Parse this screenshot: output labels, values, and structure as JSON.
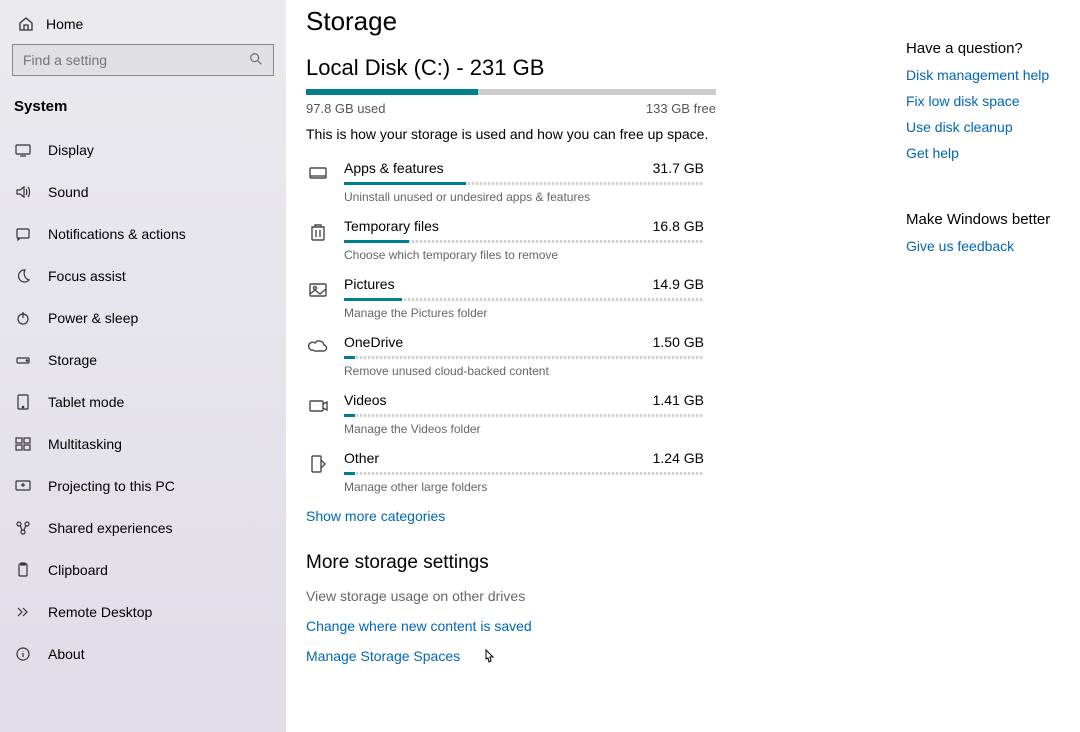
{
  "sidebar": {
    "home": "Home",
    "search_placeholder": "Find a setting",
    "system_label": "System",
    "items": [
      {
        "label": "Display"
      },
      {
        "label": "Sound"
      },
      {
        "label": "Notifications & actions"
      },
      {
        "label": "Focus assist"
      },
      {
        "label": "Power & sleep"
      },
      {
        "label": "Storage"
      },
      {
        "label": "Tablet mode"
      },
      {
        "label": "Multitasking"
      },
      {
        "label": "Projecting to this PC"
      },
      {
        "label": "Shared experiences"
      },
      {
        "label": "Clipboard"
      },
      {
        "label": "Remote Desktop"
      },
      {
        "label": "About"
      }
    ]
  },
  "page": {
    "title": "Storage",
    "disk_title": "Local Disk (C:) - 231 GB",
    "used": "97.8 GB used",
    "free": "133 GB free",
    "desc": "This is how your storage is used and how you can free up space.",
    "bar_fill_pct": 42
  },
  "categories": [
    {
      "name": "Apps & features",
      "size": "31.7 GB",
      "hint": "Uninstall unused or undesired apps & features",
      "pct": 34
    },
    {
      "name": "Temporary files",
      "size": "16.8 GB",
      "hint": "Choose which temporary files to remove",
      "pct": 18
    },
    {
      "name": "Pictures",
      "size": "14.9 GB",
      "hint": "Manage the Pictures folder",
      "pct": 16
    },
    {
      "name": "OneDrive",
      "size": "1.50 GB",
      "hint": "Remove unused cloud-backed content",
      "pct": 3
    },
    {
      "name": "Videos",
      "size": "1.41 GB",
      "hint": "Manage the Videos folder",
      "pct": 3
    },
    {
      "name": "Other",
      "size": "1.24 GB",
      "hint": "Manage other large folders",
      "pct": 3
    }
  ],
  "links": {
    "show_more": "Show more categories",
    "more_title": "More storage settings",
    "other_drives": "View storage usage on other drives",
    "change_where": "Change where new content is saved",
    "manage_spaces": "Manage Storage Spaces"
  },
  "right": {
    "q_heading": "Have a question?",
    "links": [
      "Disk management help",
      "Fix low disk space",
      "Use disk cleanup",
      "Get help"
    ],
    "better_heading": "Make Windows better",
    "feedback": "Give us feedback"
  }
}
